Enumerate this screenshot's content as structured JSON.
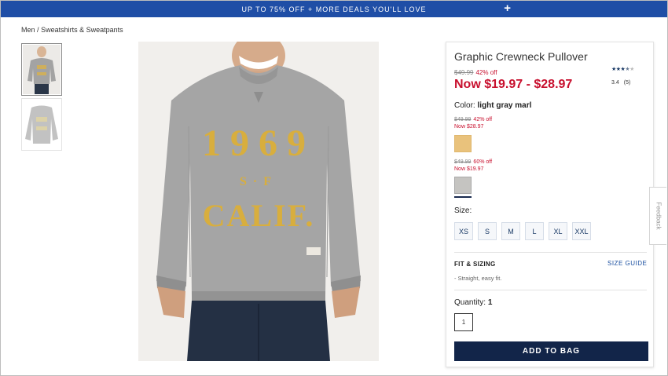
{
  "promo": {
    "text": "UP TO 75% OFF + MORE DEALS YOU'LL LOVE",
    "expand_icon": "plus-icon"
  },
  "breadcrumb": {
    "level1": "Men",
    "separator": "/",
    "level2": "Sweatshirts & Sweatpants"
  },
  "product": {
    "title": "Graphic Crewneck Pullover",
    "rating": {
      "value": "3.4",
      "count": "(5)",
      "stars": 3.4
    },
    "was_price": "$49.99",
    "percent_off": "42% off",
    "now_price": "Now $19.97 - $28.97",
    "color_label": "Color:",
    "color_value": "light gray marl",
    "swatches": [
      {
        "was": "$49.99",
        "off": "60% off",
        "now": "Now $19.97",
        "color": "#c5c4c1"
      },
      {
        "was": "$49.99",
        "off": "42% off",
        "now": "Now $28.97",
        "color": "#e9c27c"
      }
    ],
    "size_label": "Size:",
    "sizes": [
      "XS",
      "S",
      "M",
      "L",
      "XL",
      "XXL"
    ],
    "fit_label": "FIT & SIZING",
    "size_guide": "SIZE GUIDE",
    "fit_desc": "- Straight, easy fit.",
    "quantity_label": "Quantity:",
    "quantity_value": "1",
    "quantity_box": "1",
    "add_to_bag": "ADD TO BAG"
  },
  "photo": {
    "print_year": "1969",
    "print_mid": "S·F",
    "print_bottom": "CALIF."
  },
  "feedback": "Feedback",
  "colors": {
    "promo_bg": "#1f4ea6",
    "sale_red": "#c8102e",
    "button_navy": "#122549"
  }
}
